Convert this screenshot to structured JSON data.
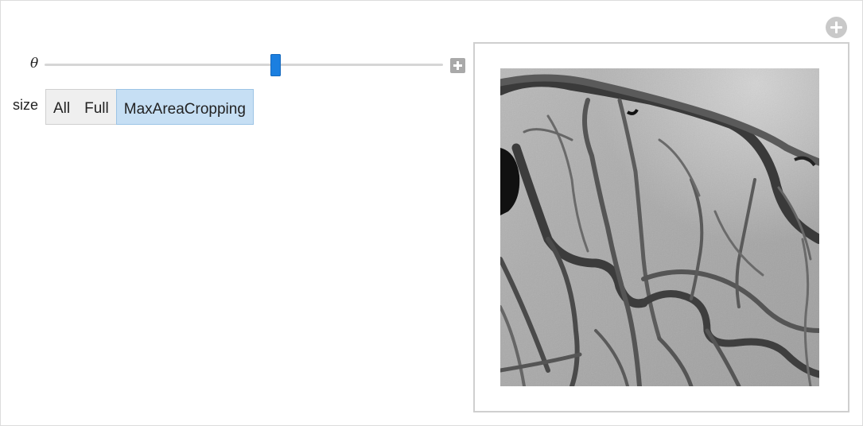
{
  "controls": {
    "theta": {
      "label": "θ",
      "value_fraction": 0.58
    },
    "size": {
      "label": "size",
      "options": [
        "All",
        "Full",
        "MaxAreaCropping"
      ],
      "selected": "MaxAreaCropping"
    }
  },
  "output": {
    "image_description_icon": "coronary-angiogram-image"
  },
  "colors": {
    "accent": "#1b7fe0",
    "selected_option": "#c6dff4",
    "panel_border": "#cfcfcf"
  }
}
